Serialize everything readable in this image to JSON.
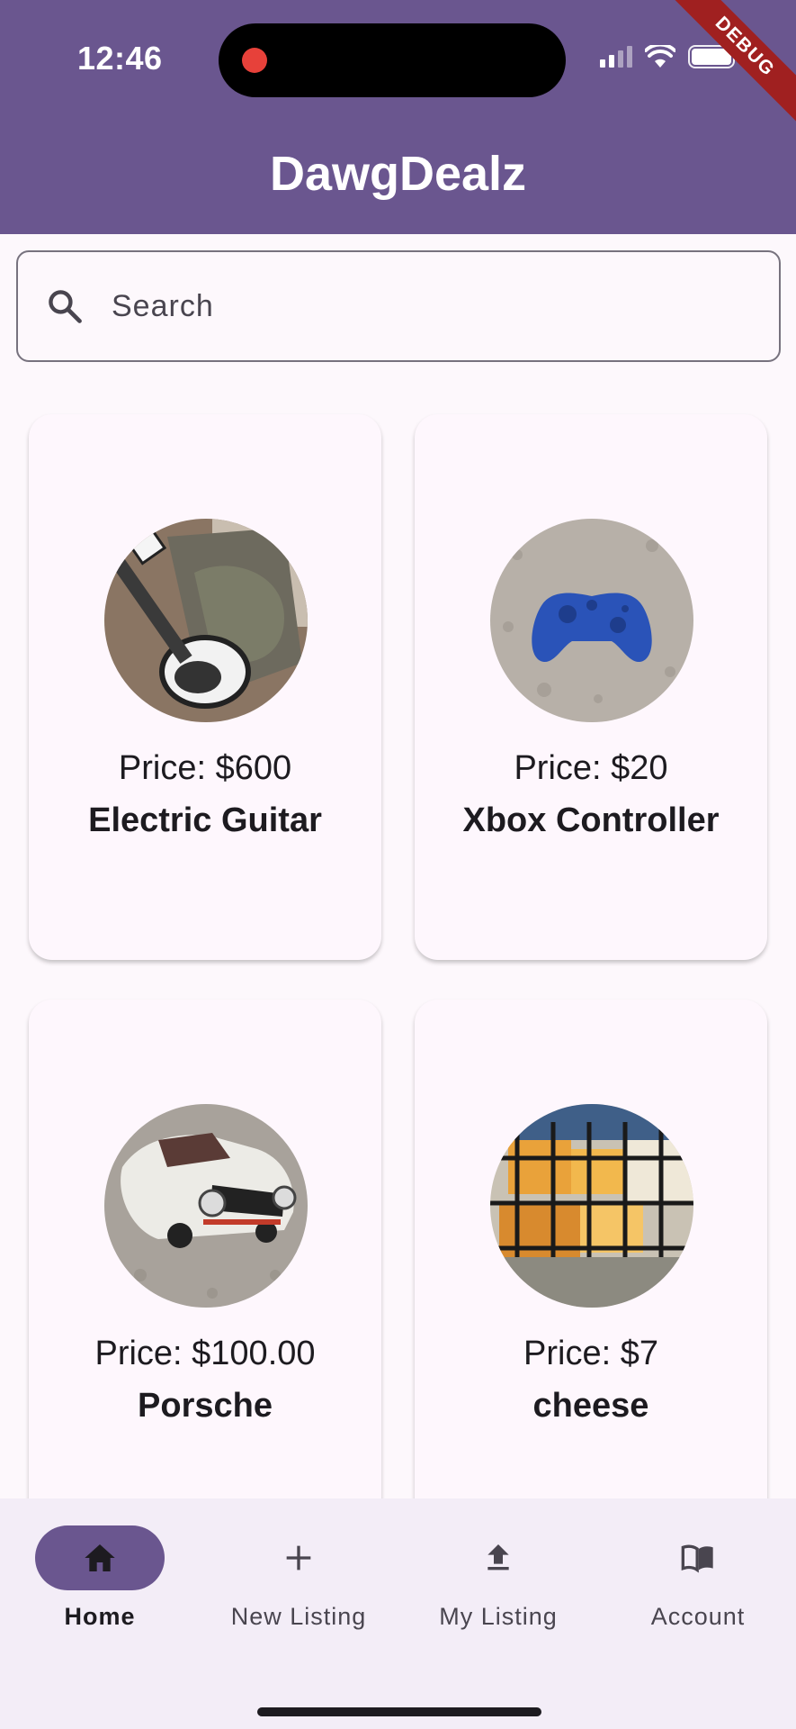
{
  "status_bar": {
    "time": "12:46",
    "debug_label": "DEBUG"
  },
  "app": {
    "title": "DawgDealz"
  },
  "search": {
    "placeholder": "Search"
  },
  "listings": [
    {
      "price": "Price: $600",
      "name": "Electric Guitar"
    },
    {
      "price": "Price: $20",
      "name": "Xbox Controller"
    },
    {
      "price": "Price: $100.00",
      "name": "Porsche"
    },
    {
      "price": "Price: $7",
      "name": "cheese"
    }
  ],
  "nav": {
    "items": [
      {
        "label": "Home",
        "icon": "home-icon",
        "active": true
      },
      {
        "label": "New Listing",
        "icon": "plus-icon",
        "active": false
      },
      {
        "label": "My Listing",
        "icon": "upload-icon",
        "active": false
      },
      {
        "label": "Account",
        "icon": "book-icon",
        "active": false
      }
    ]
  },
  "colors": {
    "primary": "#6a568f",
    "surface": "#fdf8fc",
    "nav_bg": "#f3edf7",
    "debug": "#a02020"
  }
}
